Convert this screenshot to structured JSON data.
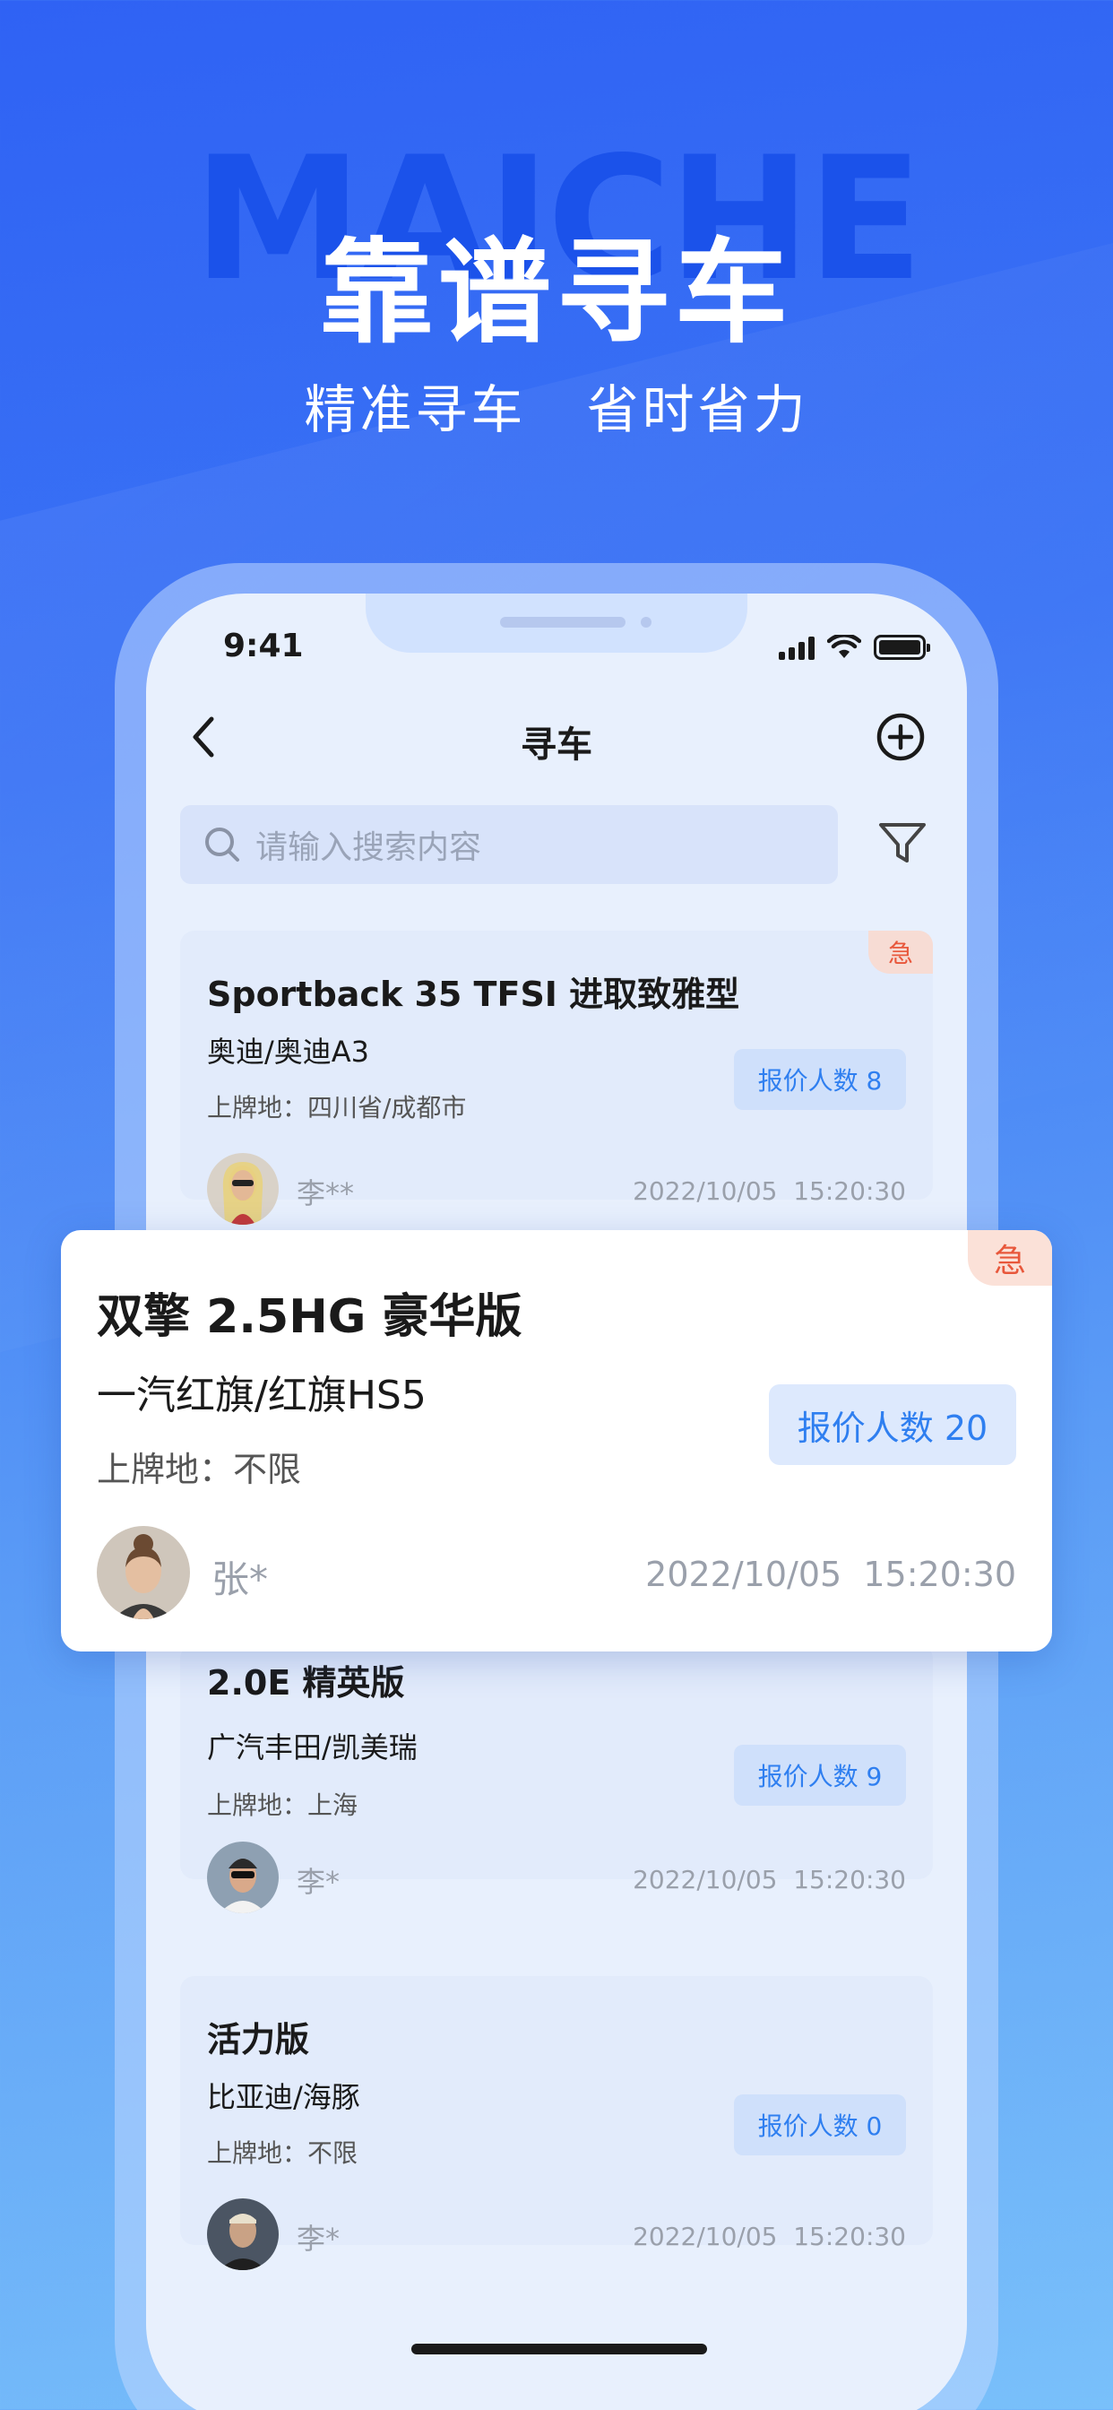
{
  "hero": {
    "watermark": "MAICHE",
    "title": "靠谱寻车",
    "subtitle": "精准寻车   省时省力"
  },
  "status_bar": {
    "time": "9:41"
  },
  "nav": {
    "title": "寻车",
    "back_icon": "chevron-left-icon",
    "add_icon": "plus-circle-icon"
  },
  "search": {
    "placeholder": "请输入搜索内容",
    "filter_icon": "filter-icon"
  },
  "colors": {
    "accent": "#2f7ff0",
    "urgent": "#e8573b",
    "background_top": "#2f62f4",
    "background_bottom": "#79c0fa"
  },
  "listings": [
    {
      "urgent": "急",
      "title": "Sportback 35 TFSI 进取致雅型",
      "model": "奥迪/奥迪A3",
      "plate": "上牌地：四川省/成都市",
      "quote": "报价人数 8",
      "user": "李**",
      "time": "2022/10/05  15:20:30"
    },
    {
      "urgent": "急",
      "title": "双擎 2.5HG 豪华版",
      "model": "一汽红旗/红旗HS5",
      "plate": "上牌地：不限",
      "quote": "报价人数 20",
      "user": "张*",
      "time": "2022/10/05  15:20:30"
    },
    {
      "title": "2.0E 精英版",
      "model": "广汽丰田/凯美瑞",
      "plate": "上牌地：上海",
      "quote": "报价人数 9",
      "user": "李*",
      "time": "2022/10/05  15:20:30"
    },
    {
      "title": "活力版",
      "model": "比亚迪/海豚",
      "plate": "上牌地：不限",
      "quote": "报价人数 0",
      "user": "李*",
      "time": "2022/10/05  15:20:30"
    }
  ]
}
